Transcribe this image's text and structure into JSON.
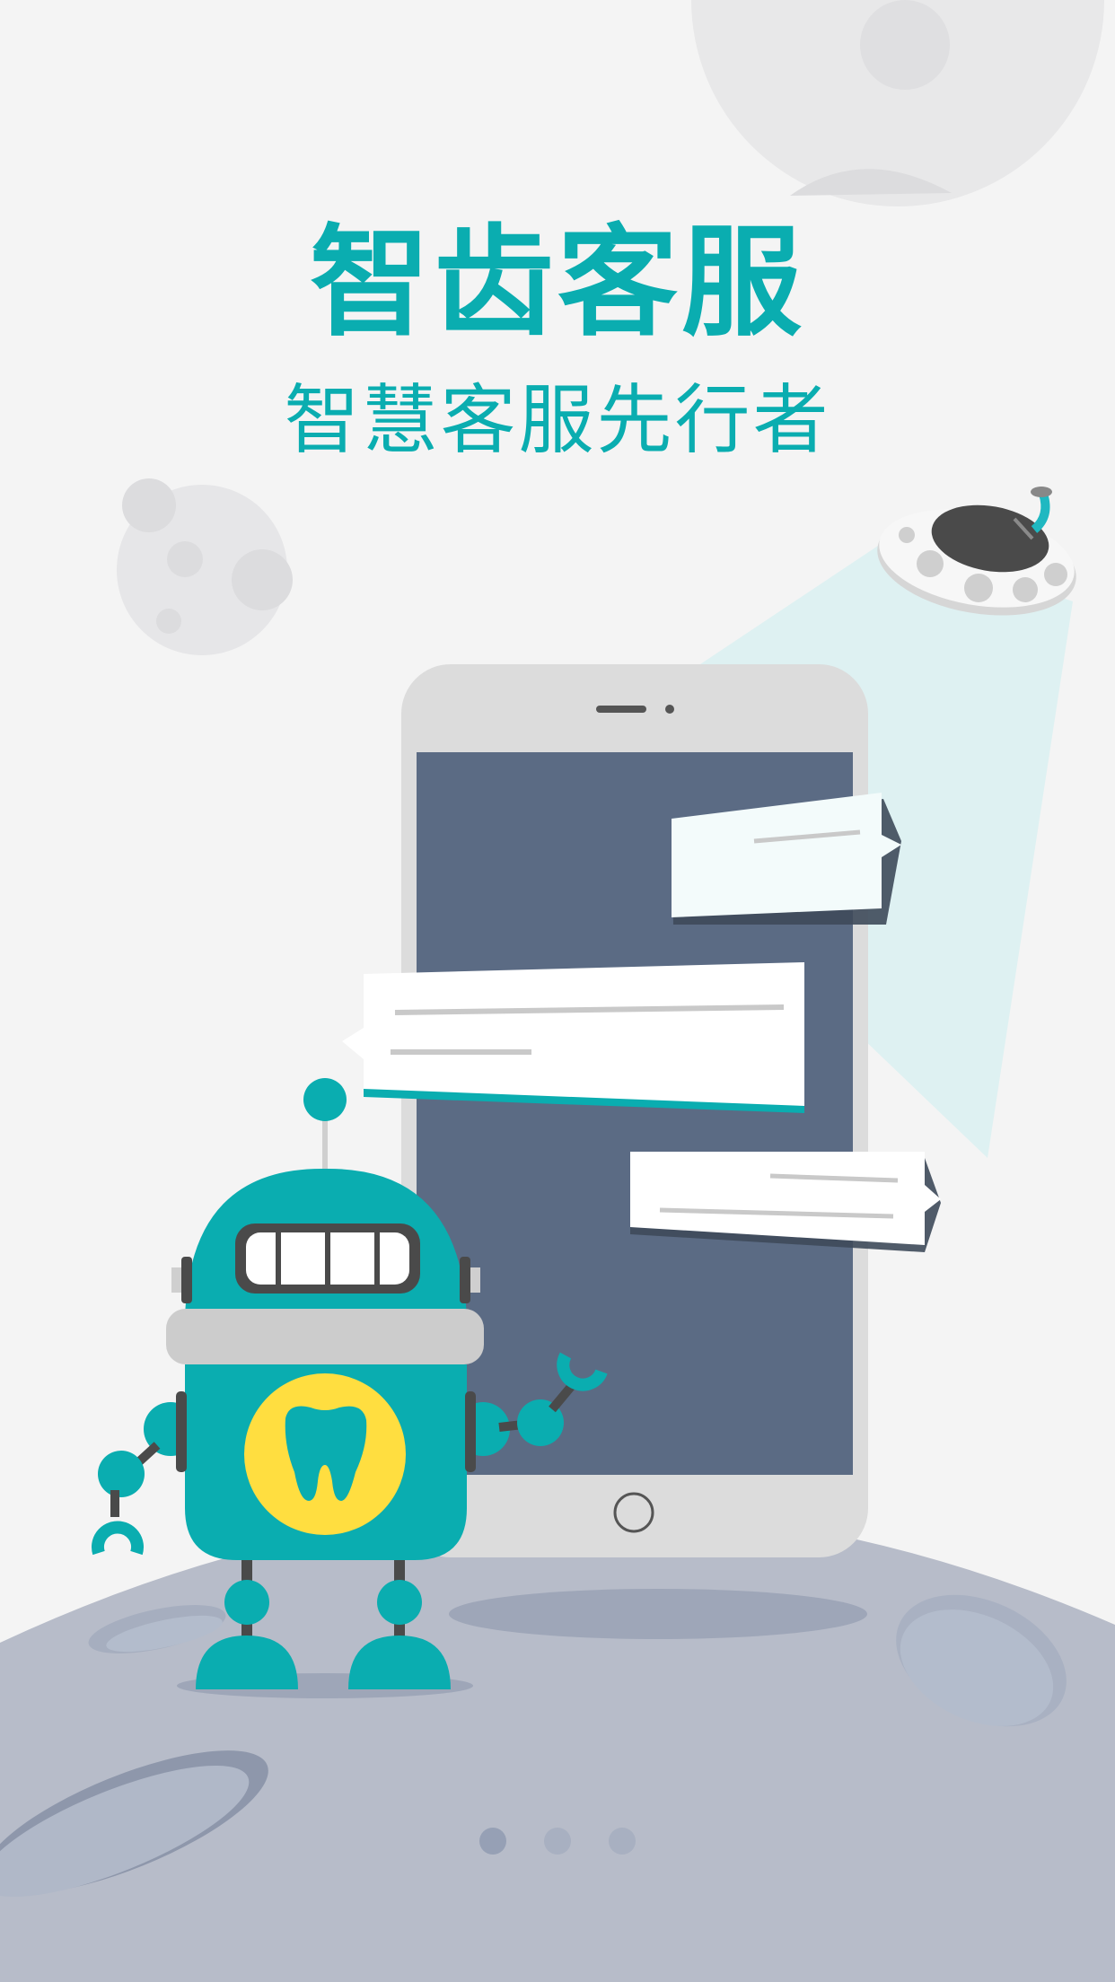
{
  "intro": {
    "title": "智齿客服",
    "subtitle": "智慧客服先行者"
  },
  "pager": {
    "page_count": 3,
    "active_index": 0
  },
  "colors": {
    "background": "#f4f4f4",
    "brand_teal": "#0aadb0",
    "planet": "#b7bcc9",
    "phone_screen": "#5b6b84",
    "phone_body": "#dcdcdc",
    "robot_badge": "#ffde40",
    "dot_active": "#96a0b5",
    "dot_inactive": "#a8b0c1"
  },
  "icons": {
    "robot": "robot-illustration",
    "tooth": "tooth-icon",
    "ufo": "ufo-illustration",
    "phone": "phone-illustration"
  }
}
